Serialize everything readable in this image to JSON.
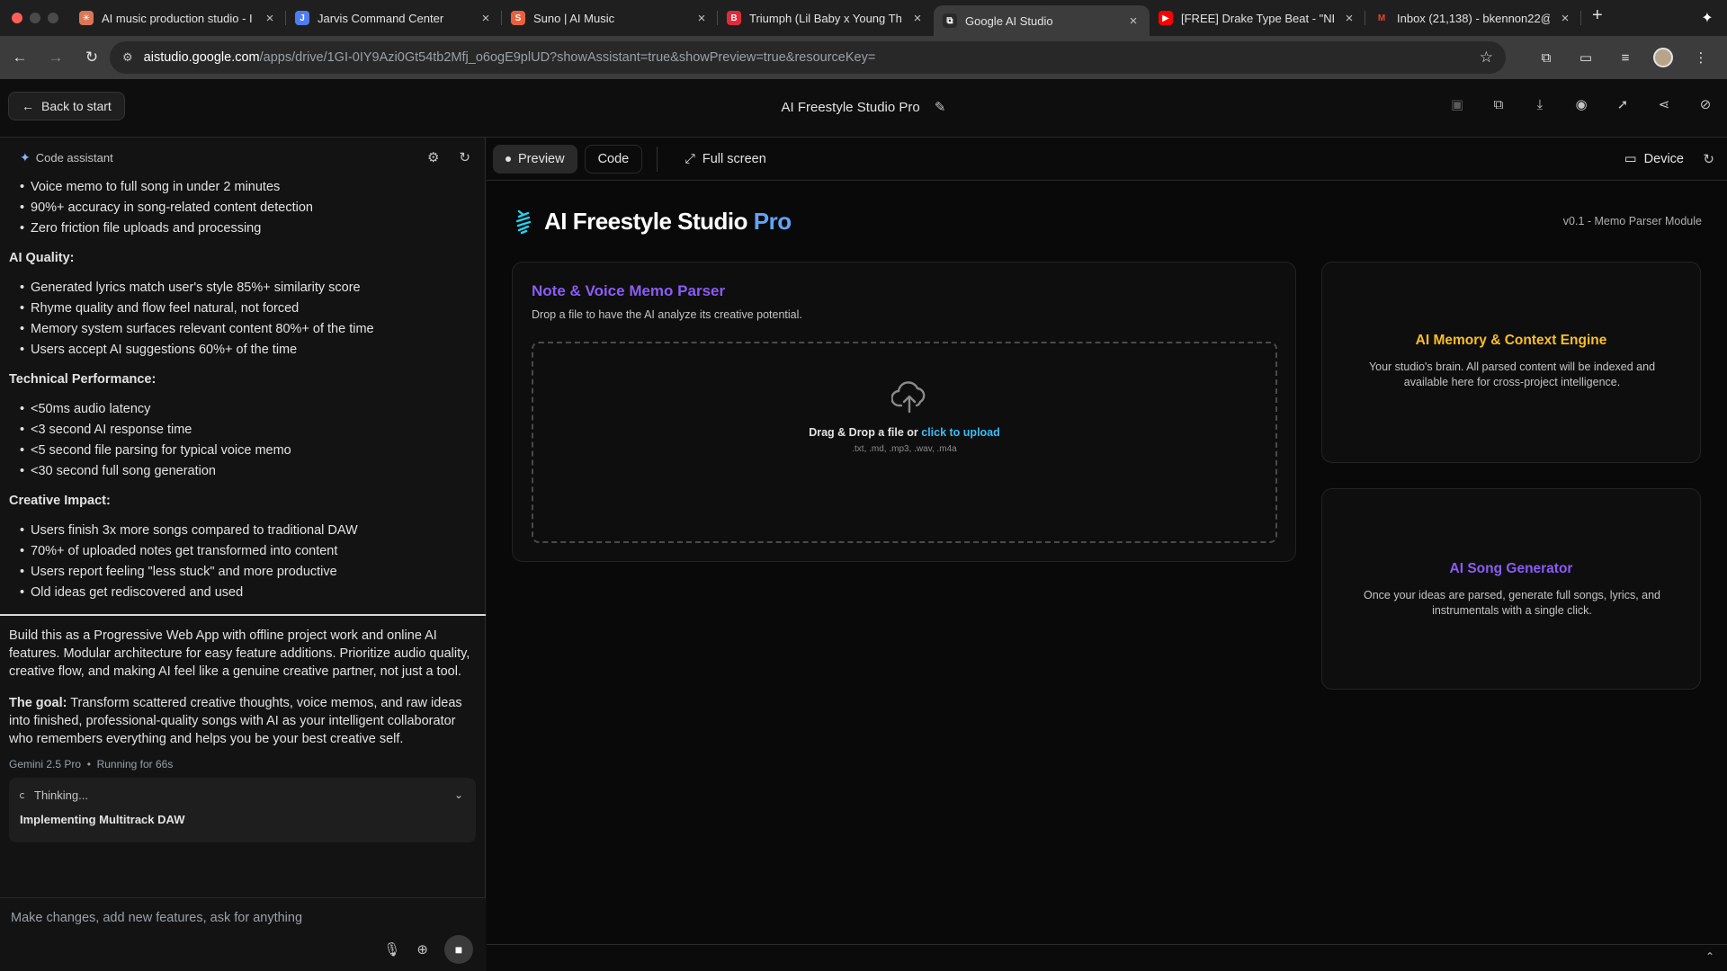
{
  "browser": {
    "tabs": [
      {
        "title": "AI music production studio - I",
        "favicon": "claude-icon",
        "color": "#d97757",
        "glyph": "✳"
      },
      {
        "title": "Jarvis Command Center",
        "favicon": "jarvis-icon",
        "color": "#4f7df0",
        "glyph": "J"
      },
      {
        "title": "Suno | AI Music",
        "favicon": "suno-icon",
        "color": "#e8603c",
        "glyph": "S"
      },
      {
        "title": "Triumph (Lil Baby x Young Th",
        "favicon": "beatstars-icon",
        "color": "#e02b3b",
        "glyph": "B"
      },
      {
        "title": "Google AI Studio",
        "favicon": "ai-studio-icon",
        "color": "#2a2a2a",
        "glyph": "⧉",
        "active": true
      },
      {
        "title": "[FREE] Drake Type Beat - \"NE",
        "favicon": "youtube-icon",
        "color": "#ff0000",
        "glyph": "▶"
      },
      {
        "title": "Inbox (21,138) - bkennon22@",
        "favicon": "gmail-icon",
        "color": "#ffffff",
        "glyph": "M"
      }
    ],
    "url_host": "aistudio.google.com",
    "url_path": "/apps/drive/1GI-0IY9Azi0Gt54tb2Mfj_o6ogE9plUD?showAssistant=true&showPreview=true&resourceKey="
  },
  "header": {
    "back_label": "Back to start",
    "app_title": "AI Freestyle Studio Pro"
  },
  "assistant": {
    "label": "Code assistant",
    "list1": [
      "Voice memo to full song in under 2 minutes",
      "90%+ accuracy in song-related content detection",
      "Zero friction file uploads and processing"
    ],
    "h_ai_quality": "AI Quality:",
    "list_ai_quality": [
      "Generated lyrics match user's style 85%+ similarity score",
      "Rhyme quality and flow feel natural, not forced",
      "Memory system surfaces relevant content 80%+ of the time",
      "Users accept AI suggestions 60%+ of the time"
    ],
    "h_tech": "Technical Performance:",
    "list_tech": [
      "<50ms audio latency",
      "<3 second AI response time",
      "<5 second file parsing for typical voice memo",
      "<30 second full song generation"
    ],
    "h_creative": "Creative Impact:",
    "list_creative": [
      "Users finish 3x more songs compared to traditional DAW",
      "70%+ of uploaded notes get transformed into content",
      "Users report feeling \"less stuck\" and more productive",
      "Old ideas get rediscovered and used"
    ],
    "para1": "Build this as a Progressive Web App with offline project work and online AI features. Modular architecture for easy feature additions. Prioritize audio quality, creative flow, and making AI feel like a genuine creative partner, not just a tool.",
    "goal_label": "The goal:",
    "goal_text": " Transform scattered creative thoughts, voice memos, and raw ideas into finished, professional-quality songs with AI as your intelligent collaborator who remembers everything and helps you be your best creative self.",
    "model": "Gemini 2.5 Pro",
    "running": "Running for 66s",
    "thinking_label": "Thinking...",
    "thinking_task": "Implementing Multitrack DAW",
    "prompt_placeholder": "Make changes, add new features, ask for anything"
  },
  "preview_toolbar": {
    "preview_label": "Preview",
    "code_label": "Code",
    "fullscreen_label": "Full screen",
    "device_label": "Device"
  },
  "app": {
    "brand_main": "AI Freestyle Studio ",
    "brand_pro": "Pro",
    "version": "v0.1 - Memo Parser Module",
    "parser_title": "Note & Voice Memo Parser",
    "parser_sub": "Drop a file to have the AI analyze its creative potential.",
    "drop_text": "Drag & Drop a file or ",
    "drop_link": "click to upload",
    "formats": ".txt, .md, .mp3, .wav, .m4a",
    "memory_title": "AI Memory & Context Engine",
    "memory_text": "Your studio's brain. All parsed content will be indexed and available here for cross-project intelligence.",
    "song_title": "AI Song Generator",
    "song_text": "Once your ideas are parsed, generate full songs, lyrics, and instrumentals with a single click."
  },
  "colors": {
    "accent_purple": "#8b5cf6",
    "accent_amber": "#fbbf24",
    "accent_blue": "#60a5fa",
    "link_blue": "#38bdf8"
  }
}
